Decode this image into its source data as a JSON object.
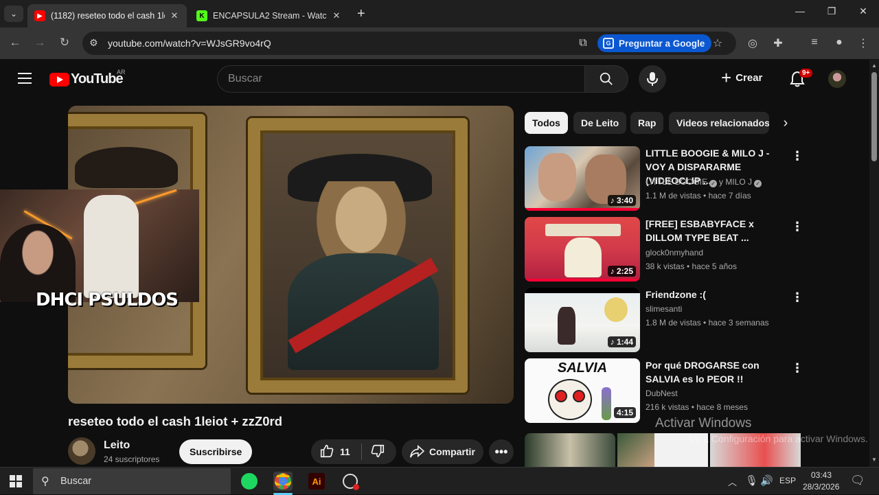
{
  "browser": {
    "tabs": [
      {
        "title": "(1182) reseteo todo el cash 1leiot",
        "active": true
      },
      {
        "title": "ENCAPSULA2 Stream - Watch L",
        "active": false
      }
    ],
    "url": "youtube.com/watch?v=WJsGR9vo4rQ",
    "ask_google": "Preguntar a Google"
  },
  "yt": {
    "logo": "YouTube",
    "country": "AR",
    "search_placeholder": "Buscar",
    "create": "Crear",
    "notifications": "9+"
  },
  "video": {
    "overlay_text": "DHCI PSULDOS",
    "title": "reseteo todo el cash 1leiot + zzZ0rd",
    "channel": "Leito",
    "subscribers": "24 suscriptores",
    "subscribe": "Suscribirse",
    "likes": "11",
    "share": "Compartir"
  },
  "chips": [
    "Todos",
    "De Leito",
    "Rap",
    "Videos relacionados"
  ],
  "related": [
    {
      "title": "LITTLE BOOGIE & MILO J - VOY A DISPARARME (VIDEOCLIP ...",
      "channel_a": "LITTLE BOOGIE",
      "channel_b": "y MILO J",
      "meta": "1.1 M de vistas • hace 7 días",
      "duration": "3:40",
      "progress": 1.0
    },
    {
      "title": "[FREE] ESBABYFACE x DILLOM TYPE BEAT ...",
      "channel": "glock0nmyhand",
      "meta": "38 k vistas • hace 5 años",
      "duration": "2:25",
      "progress": 1.0
    },
    {
      "title": "Friendzone :(",
      "channel": "slimesanti",
      "meta": "1.8 M de vistas • hace 3 semanas",
      "duration": "1:44",
      "progress": 0.0
    },
    {
      "title": "Por qué DROGARSE con SALVIA es lo PEOR !!",
      "channel": "DubNest",
      "meta": "216 k vistas • hace 8 meses",
      "duration": "4:15",
      "thumb_text": "SALVIA",
      "progress": 0.0
    }
  ],
  "watermark": {
    "line1": "Activar Windows",
    "line2": "Ve a Configuración para activar Windows."
  },
  "taskbar": {
    "search": "Buscar",
    "lang": "ESP",
    "time": "03:43",
    "date": "28/3/2026"
  },
  "colors": {
    "accent_red": "#ff0000",
    "ask_google_blue": "#0b57d0",
    "background": "#0f0f0f"
  }
}
